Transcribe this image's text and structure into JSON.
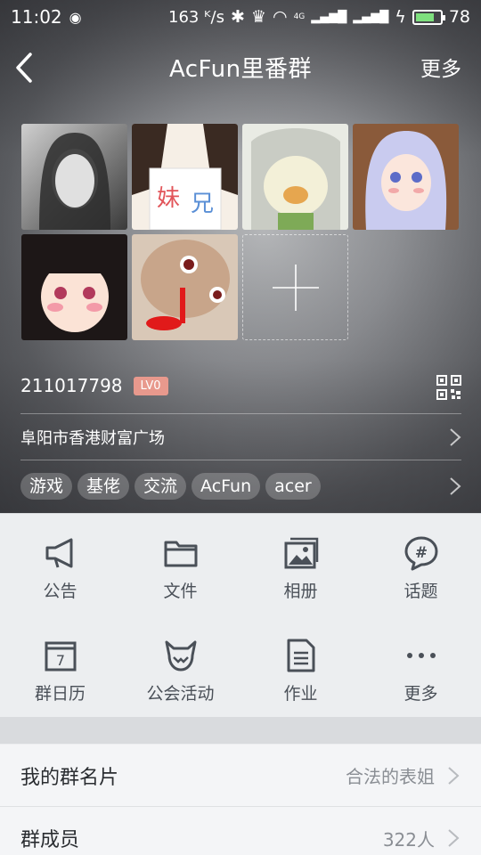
{
  "status_bar": {
    "time": "11:02",
    "network_speed": "163 ᴷ/s",
    "network_type": "4G",
    "battery": "78",
    "battery_level": 0.78
  },
  "nav": {
    "title": "AcFun里番群",
    "more_label": "更多"
  },
  "group": {
    "id": "211017798",
    "level_badge": "LV0",
    "location": "阜阳市香港财富广场",
    "tags": [
      "游戏",
      "基佬",
      "交流",
      "AcFun",
      "acer"
    ]
  },
  "features": [
    {
      "label": "公告",
      "icon": "megaphone-icon"
    },
    {
      "label": "文件",
      "icon": "folder-icon"
    },
    {
      "label": "相册",
      "icon": "photo-album-icon"
    },
    {
      "label": "话题",
      "icon": "topic-hash-icon"
    },
    {
      "label": "群日历",
      "icon": "calendar-icon"
    },
    {
      "label": "公会活动",
      "icon": "guild-activity-icon"
    },
    {
      "label": "作业",
      "icon": "homework-document-icon"
    },
    {
      "label": "更多",
      "icon": "more-dots-icon"
    }
  ],
  "settings": {
    "card_label": "我的群名片",
    "card_value": "合法的表姐",
    "members_label": "群成员",
    "members_value": "322人"
  },
  "colors": {
    "icon": "#4a5058",
    "badge": "#e8998d",
    "accent_battery": "#7ee07e"
  }
}
